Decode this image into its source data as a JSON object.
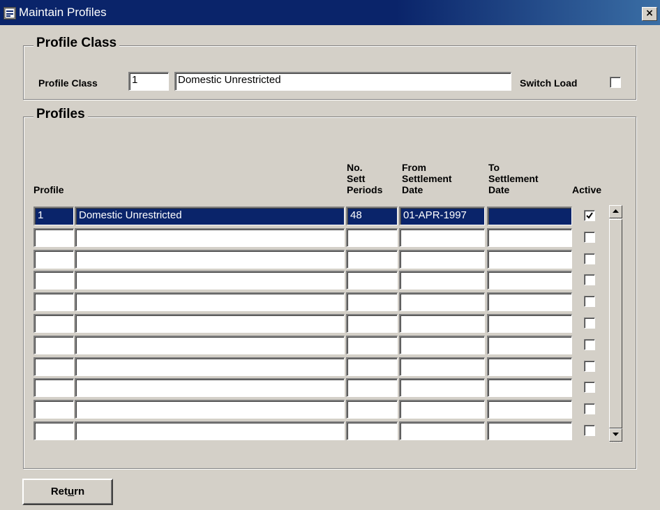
{
  "window": {
    "title": "Maintain Profiles",
    "close_glyph": "×"
  },
  "profile_class_group": {
    "title": "Profile Class",
    "label": "Profile Class",
    "code_value": "1",
    "description_value": "Domestic Unrestricted",
    "switch_load_label": "Switch Load",
    "switch_load_checked": false
  },
  "profiles_group": {
    "title": "Profiles",
    "columns": {
      "profile": "Profile",
      "sett_periods_1": "No.",
      "sett_periods_2": "Sett",
      "sett_periods_3": "Periods",
      "from_1": "From",
      "from_2": "Settlement",
      "from_3": "Date",
      "to_1": "To",
      "to_2": "Settlement",
      "to_3": "Date",
      "active": "Active"
    },
    "rows": [
      {
        "profile_code": "1",
        "description": "Domestic Unrestricted",
        "sett_periods": "48",
        "from_date": "01-APR-1997",
        "to_date": "",
        "active": true
      },
      {
        "profile_code": "",
        "description": "",
        "sett_periods": "",
        "from_date": "",
        "to_date": "",
        "active": false
      },
      {
        "profile_code": "",
        "description": "",
        "sett_periods": "",
        "from_date": "",
        "to_date": "",
        "active": false
      },
      {
        "profile_code": "",
        "description": "",
        "sett_periods": "",
        "from_date": "",
        "to_date": "",
        "active": false
      },
      {
        "profile_code": "",
        "description": "",
        "sett_periods": "",
        "from_date": "",
        "to_date": "",
        "active": false
      },
      {
        "profile_code": "",
        "description": "",
        "sett_periods": "",
        "from_date": "",
        "to_date": "",
        "active": false
      },
      {
        "profile_code": "",
        "description": "",
        "sett_periods": "",
        "from_date": "",
        "to_date": "",
        "active": false
      },
      {
        "profile_code": "",
        "description": "",
        "sett_periods": "",
        "from_date": "",
        "to_date": "",
        "active": false
      },
      {
        "profile_code": "",
        "description": "",
        "sett_periods": "",
        "from_date": "",
        "to_date": "",
        "active": false
      },
      {
        "profile_code": "",
        "description": "",
        "sett_periods": "",
        "from_date": "",
        "to_date": "",
        "active": false
      },
      {
        "profile_code": "",
        "description": "",
        "sett_periods": "",
        "from_date": "",
        "to_date": "",
        "active": false
      }
    ],
    "selected_row": 0
  },
  "buttons": {
    "return_pre": "Ret",
    "return_mnemonic": "u",
    "return_post": "rn"
  },
  "colors": {
    "face": "#d4d0c8",
    "title_bar": "#0a246a",
    "selection": "#0a246a"
  },
  "icons": [
    "app-form-icon",
    "close-icon",
    "checkmark-icon",
    "scroll-up-arrow-icon",
    "scroll-down-arrow-icon"
  ]
}
